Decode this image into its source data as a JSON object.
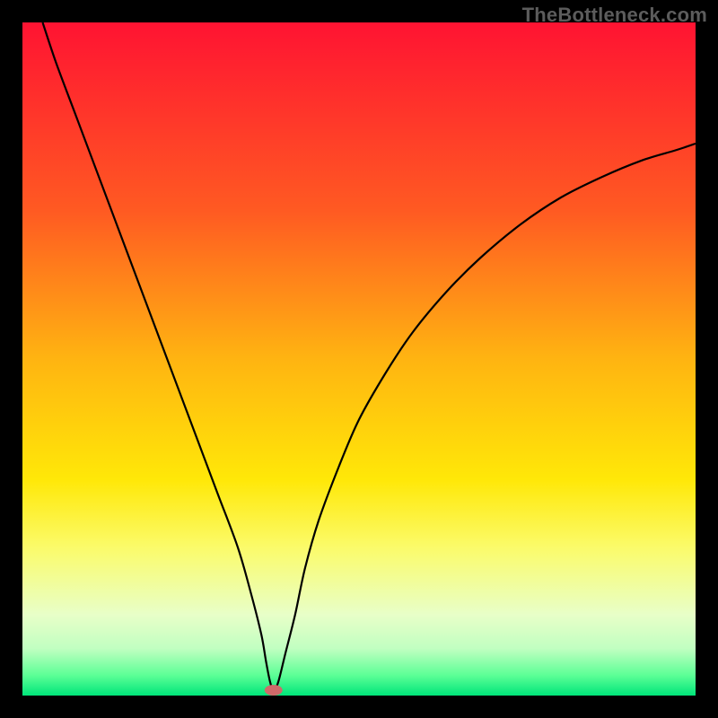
{
  "attribution": "TheBottleneck.com",
  "chart_data": {
    "type": "line",
    "title": "",
    "xlabel": "",
    "ylabel": "",
    "xlim": [
      0,
      100
    ],
    "ylim": [
      0,
      100
    ],
    "x": [
      3,
      5,
      8,
      11,
      14,
      17,
      20,
      23,
      26,
      29,
      32,
      34,
      35.5,
      36.2,
      36.8,
      37.3,
      38,
      39,
      40.5,
      42,
      44,
      47,
      50,
      54,
      58,
      63,
      68,
      74,
      80,
      86,
      92,
      97,
      100
    ],
    "y": [
      100,
      94,
      86,
      78,
      70,
      62,
      54,
      46,
      38,
      30,
      22,
      15,
      9,
      5,
      2,
      0.8,
      2,
      6,
      12,
      19,
      26,
      34,
      41,
      48,
      54,
      60,
      65,
      70,
      74,
      77,
      79.5,
      81,
      82
    ],
    "marker": {
      "x": 37.3,
      "y": 0.8
    },
    "gradient_stops": [
      {
        "pct": 0,
        "color": "#ff1332"
      },
      {
        "pct": 28,
        "color": "#ff5a22"
      },
      {
        "pct": 50,
        "color": "#ffb411"
      },
      {
        "pct": 68,
        "color": "#ffe808"
      },
      {
        "pct": 78,
        "color": "#fbfb6a"
      },
      {
        "pct": 88,
        "color": "#e8ffc8"
      },
      {
        "pct": 93,
        "color": "#c1ffc1"
      },
      {
        "pct": 97,
        "color": "#5cff96"
      },
      {
        "pct": 100,
        "color": "#00e57a"
      }
    ],
    "curve_color": "#000000",
    "marker_color": "#cf6a6a"
  }
}
